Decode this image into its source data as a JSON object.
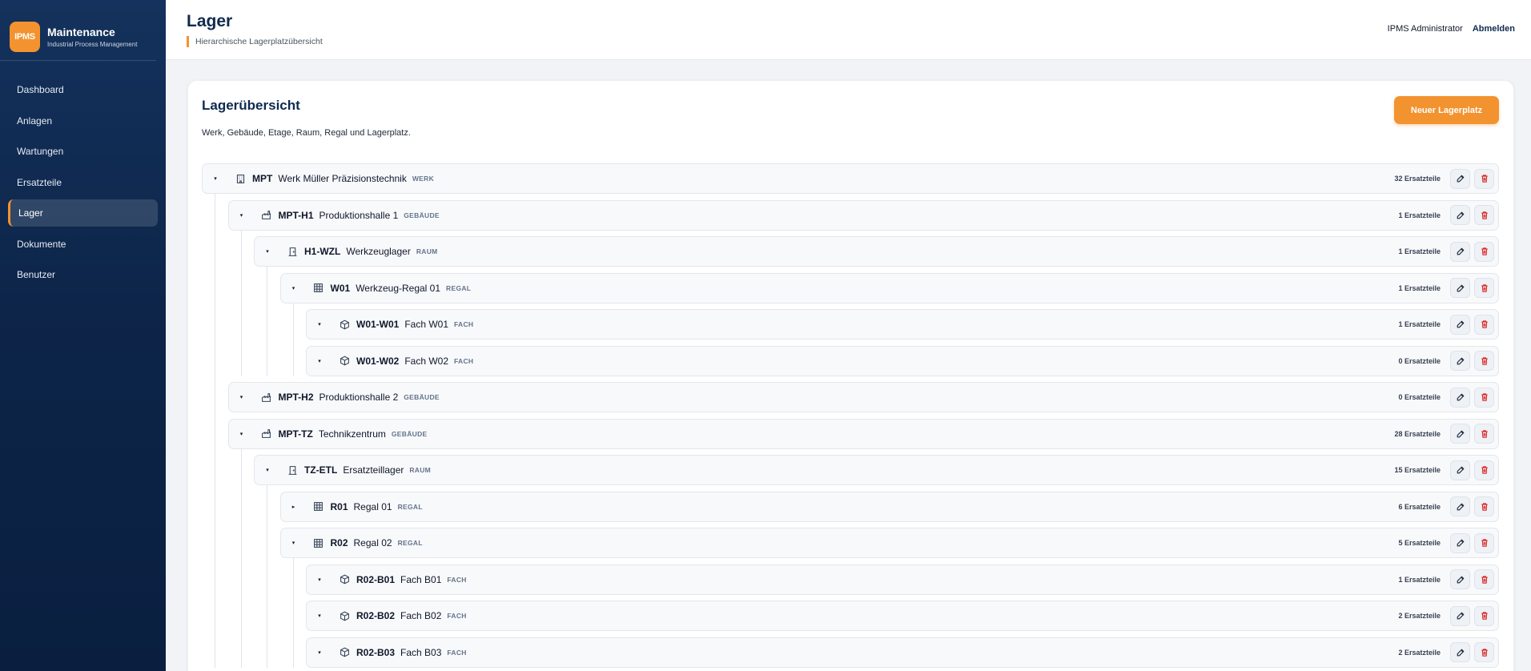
{
  "brand": {
    "logo": "IPMS",
    "title": "Maintenance",
    "subtitle": "Industrial Process Management"
  },
  "nav": [
    {
      "label": "Dashboard",
      "active": false
    },
    {
      "label": "Anlagen",
      "active": false
    },
    {
      "label": "Wartungen",
      "active": false
    },
    {
      "label": "Ersatzteile",
      "active": false
    },
    {
      "label": "Lager",
      "active": true
    },
    {
      "label": "Dokumente",
      "active": false
    },
    {
      "label": "Benutzer",
      "active": false
    }
  ],
  "header": {
    "title": "Lager",
    "subtitle": "Hierarchische Lagerplatzübersicht",
    "user": "IPMS Administrator",
    "logout": "Abmelden"
  },
  "card": {
    "title": "Lagerübersicht",
    "subtitle": "Werk, Gebäude, Etage, Raum, Regal und Lagerplatz.",
    "new_button": "Neuer Lagerplatz"
  },
  "colors": {
    "accent": "#f29330",
    "sidebar": "#0d2549",
    "primary": "#0f2a4f",
    "delete": "#dc2626"
  },
  "tree": [
    {
      "level": 0,
      "expanded": true,
      "icon": "building-icon",
      "code": "MPT",
      "name": "Werk Müller Präzisionstechnik",
      "type": "WERK",
      "count": "32 Ersatzteile"
    },
    {
      "level": 1,
      "expanded": true,
      "icon": "factory-icon",
      "code": "MPT-H1",
      "name": "Produktionshalle 1",
      "type": "GEBÄUDE",
      "count": "1 Ersatzteile"
    },
    {
      "level": 2,
      "expanded": true,
      "icon": "door-icon",
      "code": "H1-WZL",
      "name": "Werkzeuglager",
      "type": "RAUM",
      "count": "1 Ersatzteile"
    },
    {
      "level": 3,
      "expanded": true,
      "icon": "shelf-icon",
      "code": "W01",
      "name": "Werkzeug-Regal 01",
      "type": "REGAL",
      "count": "1 Ersatzteile"
    },
    {
      "level": 4,
      "expanded": true,
      "icon": "box-icon",
      "code": "W01-W01",
      "name": "Fach W01",
      "type": "FACH",
      "count": "1 Ersatzteile"
    },
    {
      "level": 4,
      "expanded": true,
      "icon": "box-icon",
      "code": "W01-W02",
      "name": "Fach W02",
      "type": "FACH",
      "count": "0 Ersatzteile"
    },
    {
      "level": 1,
      "expanded": true,
      "icon": "factory-icon",
      "code": "MPT-H2",
      "name": "Produktionshalle 2",
      "type": "GEBÄUDE",
      "count": "0 Ersatzteile"
    },
    {
      "level": 1,
      "expanded": true,
      "icon": "factory-icon",
      "code": "MPT-TZ",
      "name": "Technikzentrum",
      "type": "GEBÄUDE",
      "count": "28 Ersatzteile"
    },
    {
      "level": 2,
      "expanded": true,
      "icon": "door-icon",
      "code": "TZ-ETL",
      "name": "Ersatzteillager",
      "type": "RAUM",
      "count": "15 Ersatzteile"
    },
    {
      "level": 3,
      "expanded": false,
      "icon": "shelf-icon",
      "code": "R01",
      "name": "Regal 01",
      "type": "REGAL",
      "count": "6 Ersatzteile"
    },
    {
      "level": 3,
      "expanded": true,
      "icon": "shelf-icon",
      "code": "R02",
      "name": "Regal 02",
      "type": "REGAL",
      "count": "5 Ersatzteile"
    },
    {
      "level": 4,
      "expanded": true,
      "icon": "box-icon",
      "code": "R02-B01",
      "name": "Fach B01",
      "type": "FACH",
      "count": "1 Ersatzteile"
    },
    {
      "level": 4,
      "expanded": true,
      "icon": "box-icon",
      "code": "R02-B02",
      "name": "Fach B02",
      "type": "FACH",
      "count": "2 Ersatzteile"
    },
    {
      "level": 4,
      "expanded": true,
      "icon": "box-icon",
      "code": "R02-B03",
      "name": "Fach B03",
      "type": "FACH",
      "count": "2 Ersatzteile"
    }
  ]
}
